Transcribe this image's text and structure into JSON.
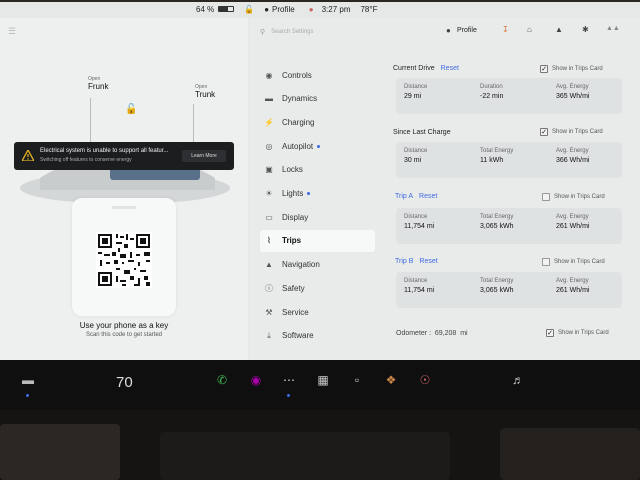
{
  "status_bar": {
    "battery": "64 %",
    "profile": "Profile",
    "time": "3:27 pm",
    "temp": "78°F"
  },
  "header": {
    "search_placeholder": "Search Settings",
    "profile": "Profile"
  },
  "car_view": {
    "frunk_open": "Open",
    "frunk": "Frunk",
    "trunk_open": "Open",
    "trunk": "Trunk"
  },
  "warning": {
    "title": "Electrical system is unable to support all featur...",
    "subtitle": "Switching off features to conserve energy",
    "button": "Learn More"
  },
  "phone_key": {
    "title": "Use your phone as a key",
    "subtitle": "Scan this code to get started"
  },
  "menu": {
    "items": [
      {
        "label": "Controls",
        "icon": "toggle-icon"
      },
      {
        "label": "Dynamics",
        "icon": "car-icon"
      },
      {
        "label": "Charging",
        "icon": "bolt-icon"
      },
      {
        "label": "Autopilot",
        "icon": "steering-wheel-icon"
      },
      {
        "label": "Locks",
        "icon": "lock-icon"
      },
      {
        "label": "Lights",
        "icon": "sun-icon"
      },
      {
        "label": "Display",
        "icon": "display-icon"
      },
      {
        "label": "Trips",
        "icon": "trips-icon"
      },
      {
        "label": "Navigation",
        "icon": "navigation-arrow-icon"
      },
      {
        "label": "Safety",
        "icon": "info-icon"
      },
      {
        "label": "Service",
        "icon": "wrench-icon"
      },
      {
        "label": "Software",
        "icon": "download-icon"
      }
    ]
  },
  "trips": {
    "show_label": "Show in Trips Card",
    "current_drive": {
      "title": "Current Drive",
      "reset": "Reset",
      "show_checked": true,
      "stats": [
        {
          "key": "Distance",
          "value": "29 mi"
        },
        {
          "key": "Duration",
          "value": "-22 min"
        },
        {
          "key": "Avg. Energy",
          "value": "365 Wh/mi"
        }
      ]
    },
    "since_charge": {
      "title": "Since Last Charge",
      "show_checked": true,
      "stats": [
        {
          "key": "Distance",
          "value": "30 mi"
        },
        {
          "key": "Total Energy",
          "value": "11 kWh"
        },
        {
          "key": "Avg. Energy",
          "value": "366 Wh/mi"
        }
      ]
    },
    "trip_a": {
      "title": "Trip A",
      "reset": "Reset",
      "show_checked": false,
      "stats": [
        {
          "key": "Distance",
          "value": "11,754 mi"
        },
        {
          "key": "Total Energy",
          "value": "3,065 kWh"
        },
        {
          "key": "Avg. Energy",
          "value": "261 Wh/mi"
        }
      ]
    },
    "trip_b": {
      "title": "Trip B",
      "reset": "Reset",
      "show_checked": false,
      "stats": [
        {
          "key": "Distance",
          "value": "11,754 mi"
        },
        {
          "key": "Total Energy",
          "value": "3,065 kWh"
        },
        {
          "key": "Avg. Energy",
          "value": "261 Wh/mi"
        }
      ]
    },
    "odometer": {
      "label": "Odometer :  69,208  mi",
      "show_checked": true
    }
  },
  "taskbar": {
    "temperature": "70"
  },
  "colors": {
    "accent": "#3e6ae1",
    "screen_bg": "#e9ebeb",
    "taskbar_bg": "#0f0f10"
  }
}
